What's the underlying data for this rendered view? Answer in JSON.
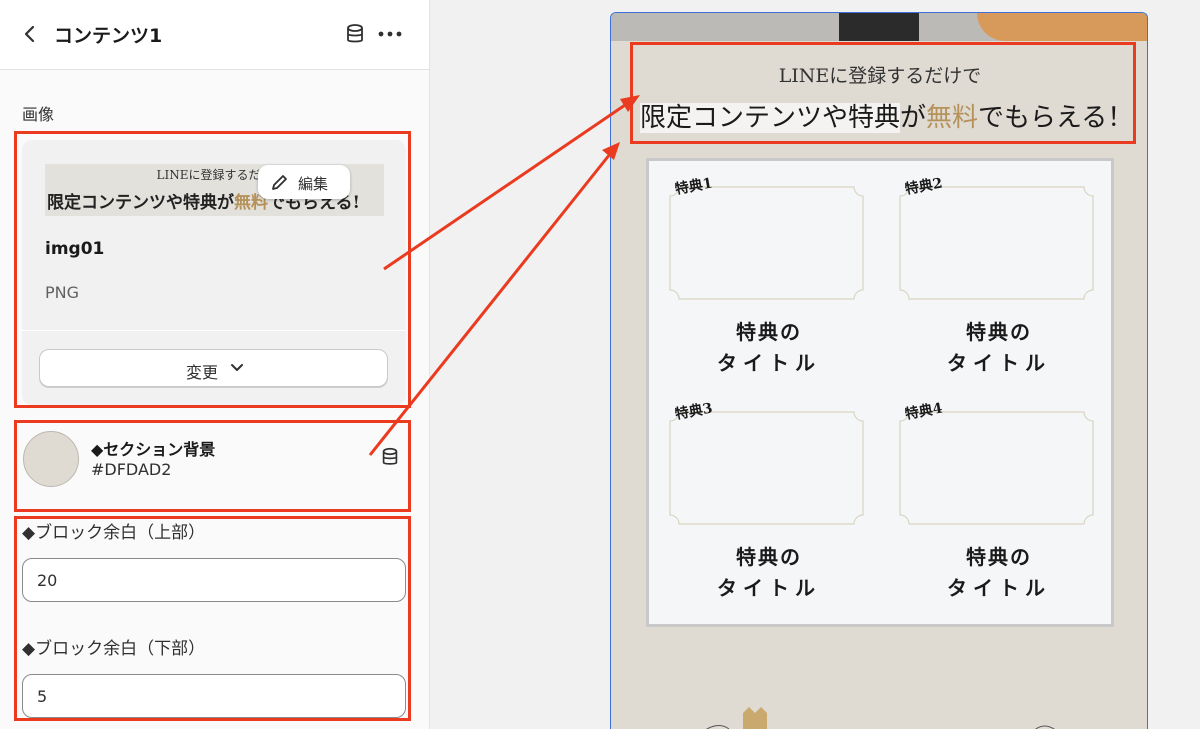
{
  "panel": {
    "title": "コンテンツ1",
    "icons": {
      "back": "chevron-left-icon",
      "database": "database-icon",
      "more": "more-horizontal-icon"
    }
  },
  "image_setting": {
    "label": "画像",
    "thumbnail": {
      "line1": "LINEに登録するだけ",
      "line2_prefix": "限定コンテンツや特典が",
      "line2_accent": "無料",
      "line2_suffix": "でもらえる!"
    },
    "edit_label": "編集",
    "file_name": "img01",
    "file_type": "PNG",
    "change_label": "変更"
  },
  "background_setting": {
    "title": "◆セクション背景",
    "value": "#DFDAD2",
    "color": "#DFDAD2"
  },
  "padding_top": {
    "label": "◆ブロック余白（上部）",
    "value": "20"
  },
  "padding_bottom": {
    "label": "◆ブロック余白（下部）",
    "value": "5"
  },
  "preview": {
    "headline_sub": "LINEに登録するだけで",
    "headline_main_prefix": "限定コンテンツや特典",
    "headline_main_ga": "が",
    "headline_main_accent": "無料",
    "headline_main_suffix": "でもらえる！",
    "bonuses": [
      {
        "label": "特典1",
        "title_line1": "特典の",
        "title_line2": "タイトル"
      },
      {
        "label": "特典2",
        "title_line1": "特典の",
        "title_line2": "タイトル"
      },
      {
        "label": "特典3",
        "title_line1": "特典の",
        "title_line2": "タイトル"
      },
      {
        "label": "特典4",
        "title_line1": "特典の",
        "title_line2": "タイトル"
      }
    ]
  },
  "colors": {
    "annotation_red": "#EA3A1F",
    "accent_gold": "#B5925A",
    "selection_blue": "#3F6FD8"
  }
}
